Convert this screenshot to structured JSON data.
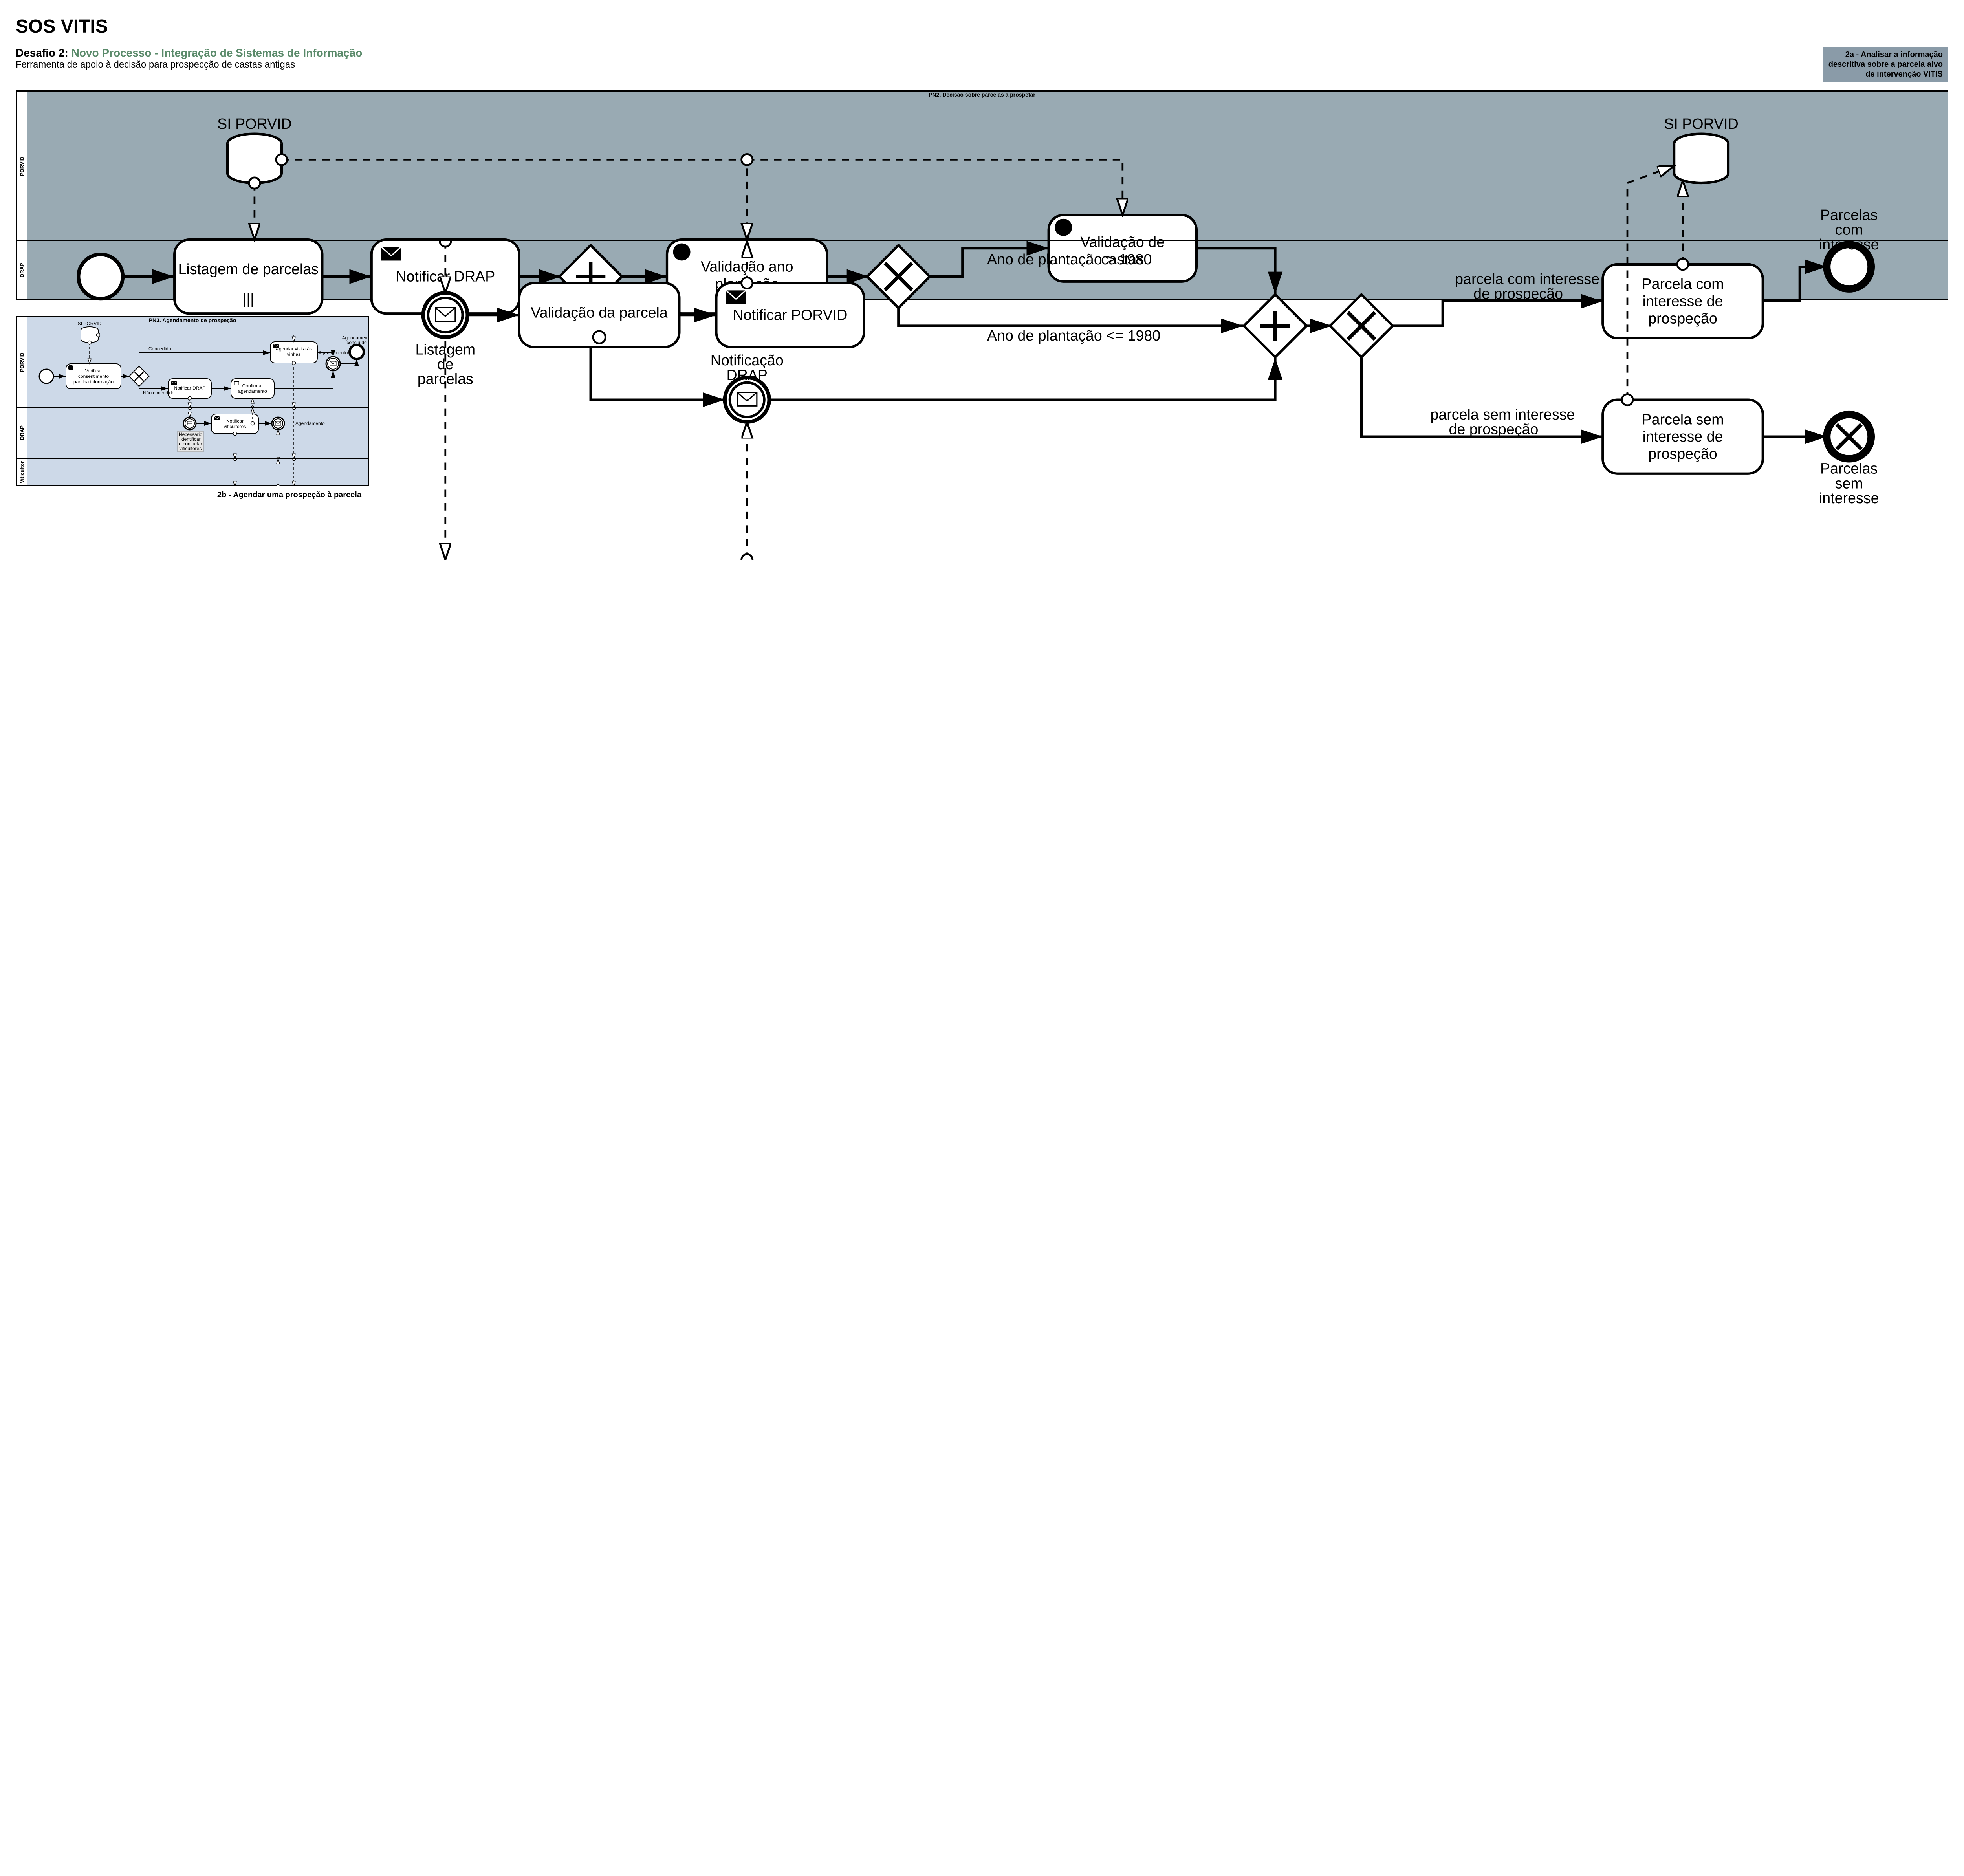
{
  "title": "SOS VITIS",
  "challenge": {
    "label": "Desafio 2:",
    "name": "Novo Processo - Integração de Sistemas de Informação",
    "subtitle": "Ferramenta de apoio à decisão para prospecção de castas antigas"
  },
  "tag2a": "2a - Analisar a informação descritiva sobre a parcela alvo de intervenção VITIS",
  "tag2b": "2b - Agendar uma prospeção à parcela",
  "pool2a": {
    "title": "PN2. Decisão sobre parcelas a prospetar",
    "lanes": {
      "porvid": "PORVID",
      "drap": "DRAP"
    },
    "datastores": {
      "si_porvid_left": "SI PORVID",
      "si_porvid_right": "SI PORVID"
    },
    "tasks": {
      "listagem": "Listagem de parcelas",
      "notificar_drap": "Notificar DRAP",
      "valid_ano": "Validação ano plantação",
      "valid_castas": "Validação de castas",
      "parcela_com": "Parcela com interesse de prospeção",
      "parcela_sem": "Parcela sem interesse de prospeção",
      "validacao_parcela": "Validação da parcela",
      "notificar_porvid": "Notificar PORVID"
    },
    "events": {
      "notif_drap_inter": "Notificação DRAP",
      "listagem_msg": "Listagem de parcelas",
      "end_com": "Parcelas com interesse",
      "end_sem": "Parcelas sem interesse"
    },
    "edges": {
      "ano_gt": "Ano de plantação > 1980",
      "ano_lte": "Ano de plantação <= 1980",
      "parcela_com_label": "parcela com interesse de prospeção",
      "parcela_sem_label": "parcela sem interesse de prospeção"
    }
  },
  "pool2b": {
    "title": "PN3. Agendamento de prospeção",
    "lanes": {
      "porvid": "PORVID",
      "drap": "DRAP",
      "viticultor": "Viticultor"
    },
    "datastores": {
      "si_porvid": "SI PORVID"
    },
    "tasks": {
      "verificar": "Verificar consentimento partilha informação",
      "notificar_drap": "Notificar DRAP",
      "confirmar": "Confirmar agendamento",
      "agendar": "Agendar visita às vinhas",
      "notificar_viticultores": "Notificar viticultores"
    },
    "events": {
      "agendamento_inter": "Agendamento",
      "agendamento_drap": "Agendamento",
      "end": "Agendamento concluído",
      "necessario": "Necessário identificar e contactar viticultores"
    },
    "edges": {
      "concedido": "Concedido",
      "nao_concedido": "Não concedido"
    }
  }
}
